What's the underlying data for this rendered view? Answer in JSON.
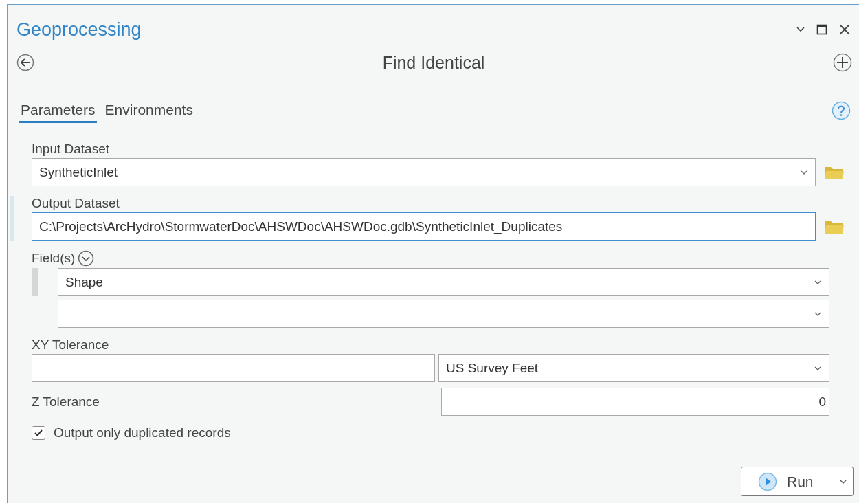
{
  "window": {
    "title": "Geoprocessing"
  },
  "tool": {
    "name": "Find Identical"
  },
  "tabs": [
    {
      "label": "Parameters",
      "selected": true
    },
    {
      "label": "Environments",
      "selected": false
    }
  ],
  "input_dataset": {
    "label": "Input Dataset",
    "value": "SyntheticInlet",
    "focused": false
  },
  "output_dataset": {
    "label": "Output Dataset",
    "value": "C:\\Projects\\ArcHydro\\StormwaterDoc\\AHSWDoc\\AHSWDoc.gdb\\SyntheticInlet_Duplicates",
    "focused": true
  },
  "fields": {
    "label": "Field(s)",
    "rows": [
      {
        "kind": "value",
        "value": "Shape"
      },
      {
        "kind": "blank"
      }
    ]
  },
  "xy_tolerance": {
    "label": "XY Tolerance",
    "unit": "US Survey Feet"
  },
  "z_tolerance": {
    "label": "Z Tolerance",
    "value": "0"
  },
  "option": {
    "label": "Output only duplicated records",
    "checked": true
  },
  "run_button": {
    "label": "Run"
  }
}
